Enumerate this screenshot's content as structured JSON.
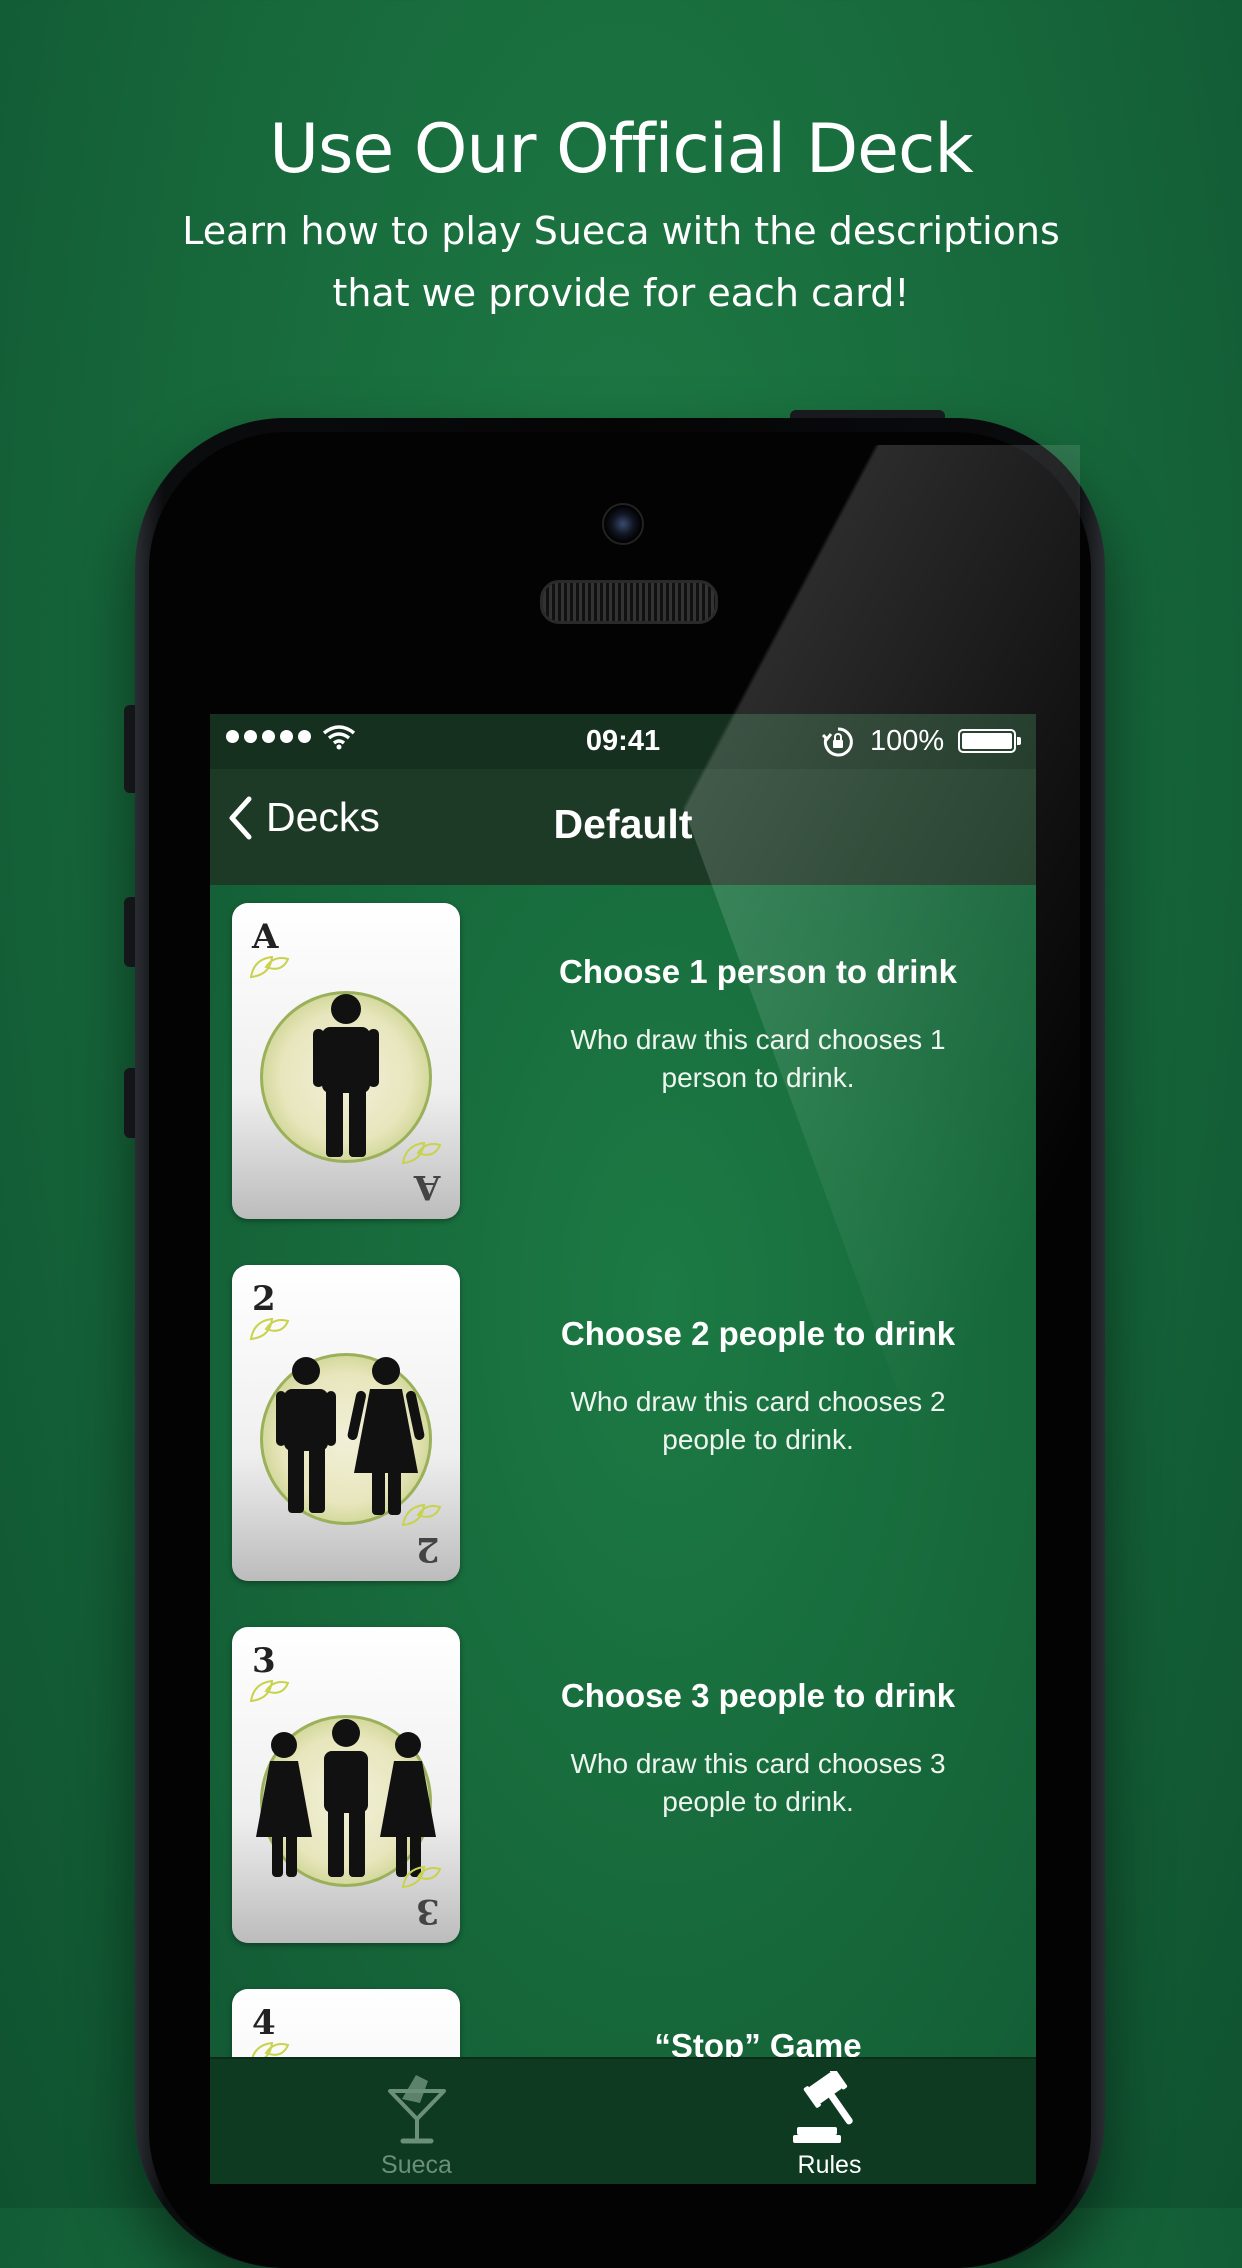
{
  "promo": {
    "title": "Use Our Official Deck",
    "subtitle": "Learn how to play Sueca with the descriptions that we provide for each card!"
  },
  "status_bar": {
    "time": "09:41",
    "battery": "100%",
    "signal_icon": "signal-dots-icon",
    "wifi_icon": "wifi-icon",
    "lock_icon": "rotation-lock-icon"
  },
  "nav": {
    "back_label": "Decks",
    "title": "Default"
  },
  "rules": [
    {
      "rank": "A",
      "title": "Choose 1 person to drink",
      "description": "Who draw this card chooses 1 person to drink."
    },
    {
      "rank": "2",
      "title": "Choose 2 people to drink",
      "description": "Who draw this card chooses 2 people to drink."
    },
    {
      "rank": "3",
      "title": "Choose 3 people to drink",
      "description": "Who draw this card chooses 3 people to drink."
    },
    {
      "rank": "4",
      "title": "“Stop” Game",
      "description": ""
    }
  ],
  "tabs": [
    {
      "label": "Sueca",
      "icon": "cocktail-glass-icon",
      "active": false
    },
    {
      "label": "Rules",
      "icon": "gavel-icon",
      "active": true
    }
  ],
  "colors": {
    "background": "#16663a",
    "nav_bar": "#1d3a26",
    "tab_bar": "#0e3a22",
    "tab_active": "#ffffff",
    "tab_inactive": "#6b8f78"
  }
}
